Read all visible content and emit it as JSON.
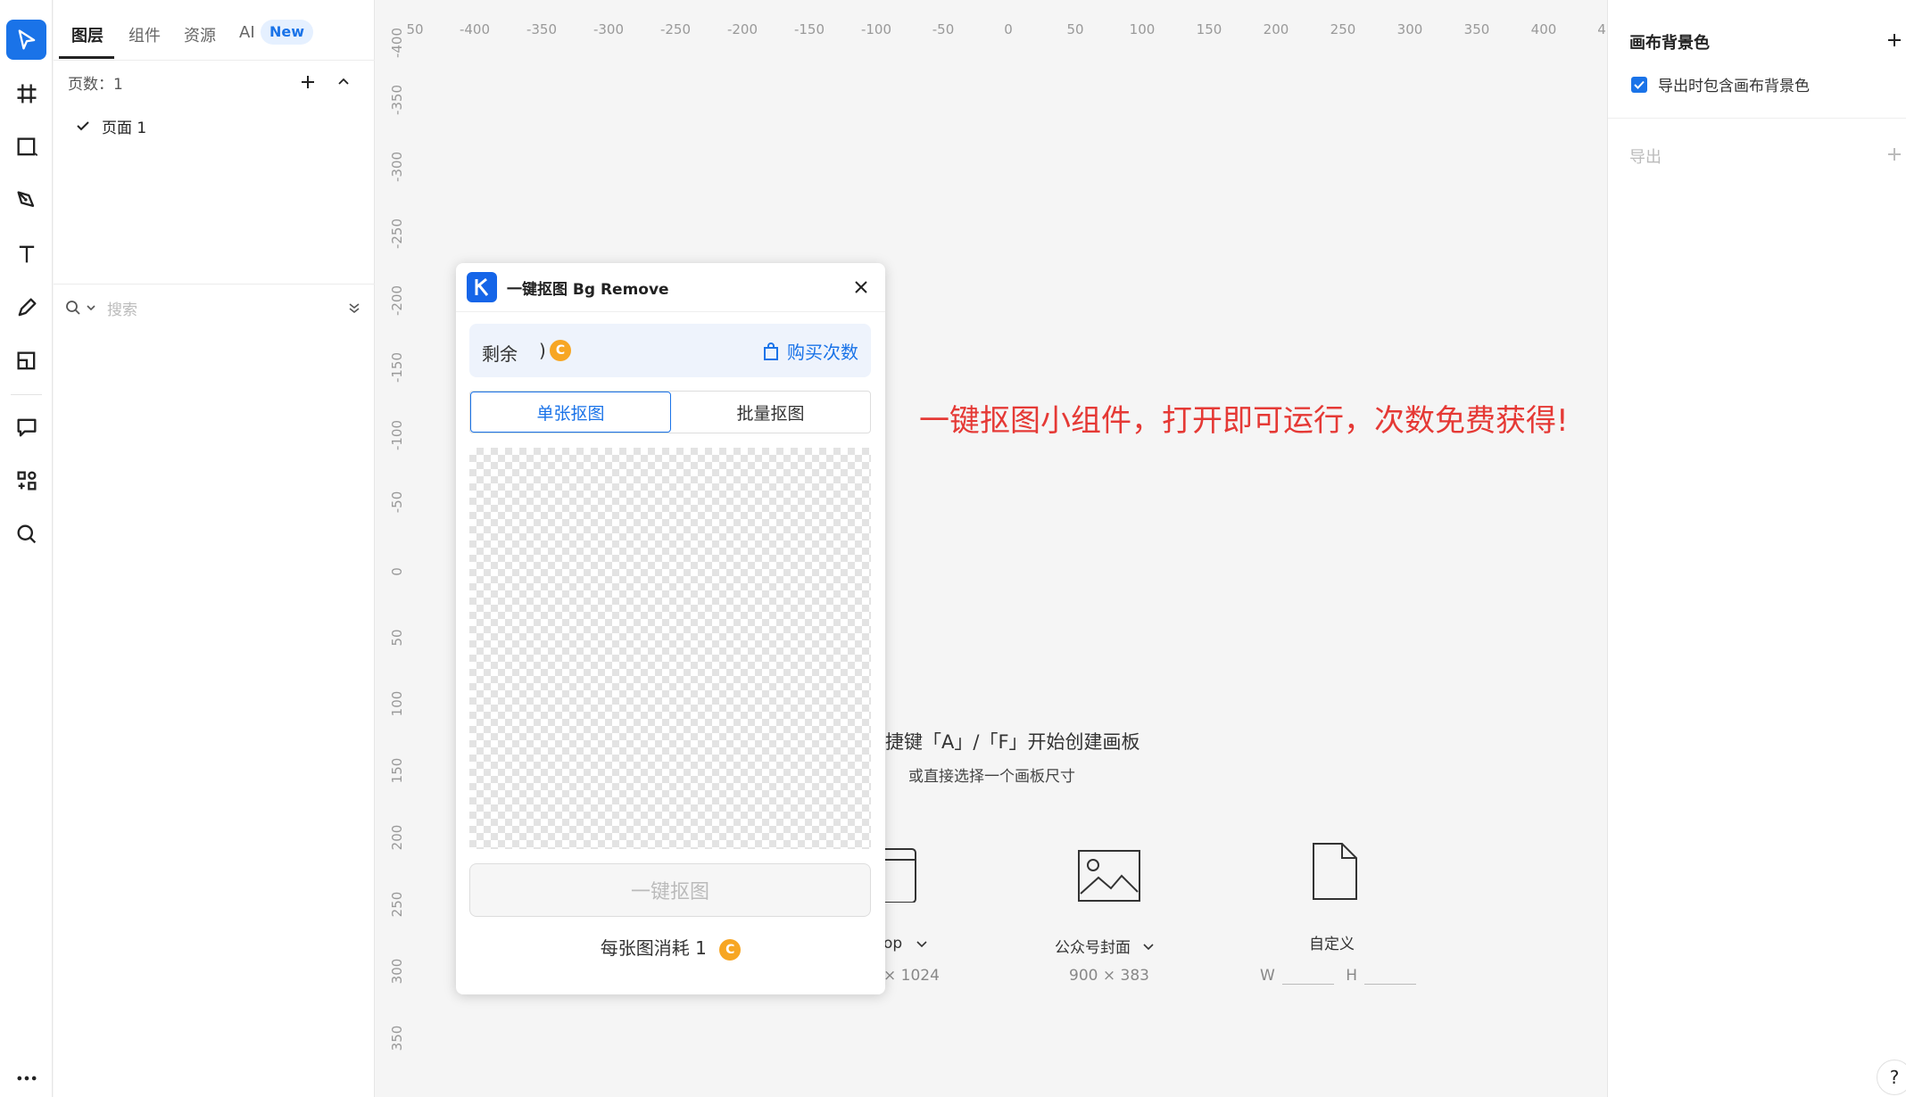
{
  "tabs": {
    "layers": "图层",
    "components": "组件",
    "assets": "资源",
    "ai": "AI",
    "ai_badge": "New"
  },
  "pages": {
    "count_label": "页数：1",
    "items": [
      "页面 1"
    ]
  },
  "search": {
    "placeholder": "搜索"
  },
  "ruler": {
    "top": [
      "50",
      "-400",
      "-350",
      "-300",
      "-250",
      "-200",
      "-150",
      "-100",
      "-50",
      "0",
      "50",
      "100",
      "150",
      "200",
      "250",
      "300",
      "350",
      "400",
      "4"
    ],
    "left": [
      "-400",
      "-350",
      "-300",
      "-250",
      "-200",
      "-150",
      "-100",
      "-50",
      "0",
      "50",
      "100",
      "150",
      "200",
      "250",
      "300",
      "350"
    ]
  },
  "canvas": {
    "promo_text": "一键抠图小组件，打开即可运行，次数免费获得!",
    "hint_main": "捷键「A」/「F」开始创建画板",
    "hint_sub": "或直接选择一个画板尺寸",
    "presets": [
      {
        "label": "op",
        "size": "× 1024"
      },
      {
        "label": "公众号封面",
        "size": "900 × 383"
      },
      {
        "label": "自定义",
        "w_label": "W",
        "h_label": "H"
      }
    ]
  },
  "right_panel": {
    "bg_title": "画布背景色",
    "include_bg_label": "导出时包含画布背景色",
    "include_bg_checked": true,
    "export_title": "导出"
  },
  "dialog": {
    "title": "一键抠图 Bg Remove",
    "credits_label": "剩余",
    "credits_paren": ")",
    "buy_label": "购买次数",
    "seg_single": "单张抠图",
    "seg_batch": "批量抠图",
    "run_label": "一键抠图",
    "cost_label": "每张图消耗 1"
  },
  "help": "?",
  "colors": {
    "accent": "#1a73e8",
    "promo": "#e53935",
    "coin": "#f7a623"
  }
}
